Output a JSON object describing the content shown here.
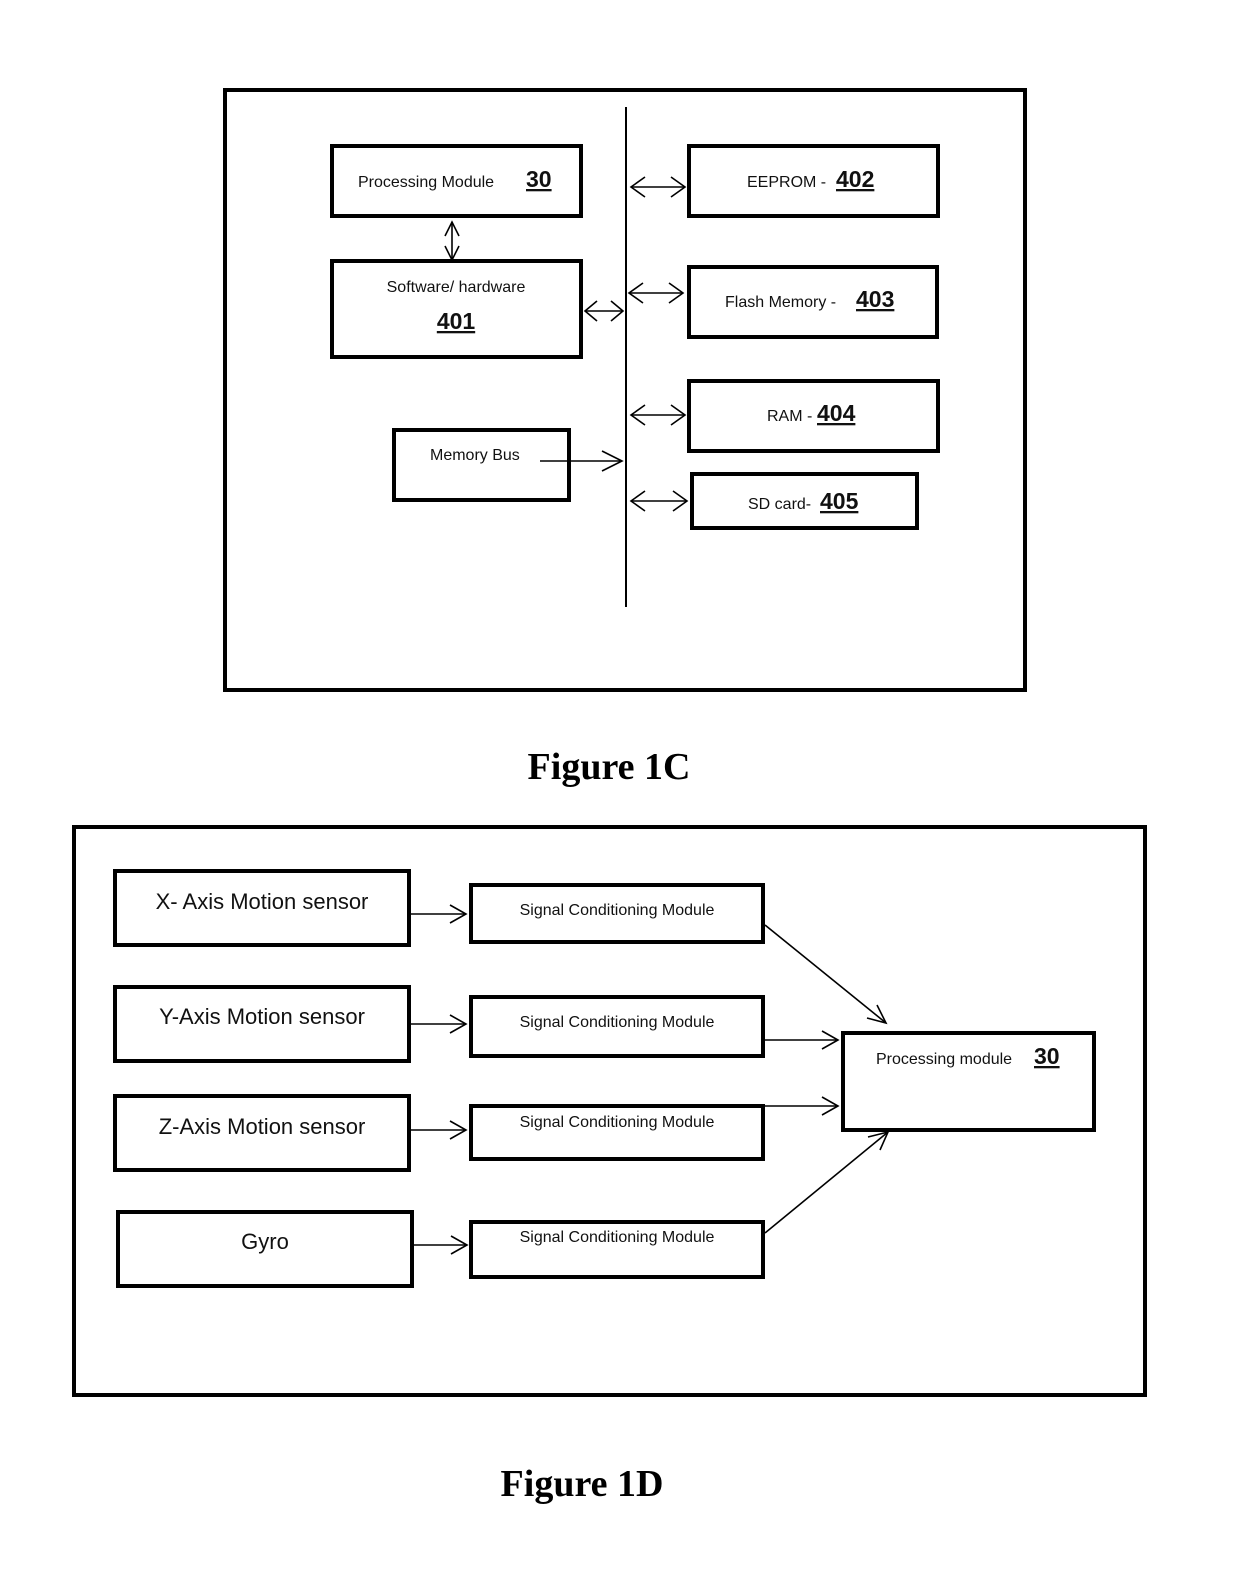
{
  "figure_1c": {
    "caption": "Figure 1C",
    "processing_module": {
      "label": "Processing Module",
      "ref": "30"
    },
    "software_hardware": {
      "label": "Software/ hardware",
      "ref": "401"
    },
    "memory_bus": {
      "label": "Memory Bus"
    },
    "eeprom": {
      "label": "EEPROM -",
      "ref": "402"
    },
    "flash": {
      "label": "Flash Memory -",
      "ref": "403"
    },
    "ram": {
      "label": "RAM -",
      "ref": "404"
    },
    "sd_card": {
      "label": "SD card-",
      "ref": "405"
    }
  },
  "figure_1d": {
    "caption": "Figure 1D",
    "sensors": [
      {
        "label": "X- Axis Motion sensor"
      },
      {
        "label": "Y-Axis Motion sensor"
      },
      {
        "label": "Z-Axis Motion sensor"
      },
      {
        "label": "Gyro"
      }
    ],
    "conditioners": [
      {
        "label": "Signal Conditioning Module"
      },
      {
        "label": "Signal Conditioning Module"
      },
      {
        "label": "Signal Conditioning Module"
      },
      {
        "label": "Signal Conditioning Module"
      }
    ],
    "processing_module": {
      "label": "Processing module",
      "ref": "30"
    }
  }
}
